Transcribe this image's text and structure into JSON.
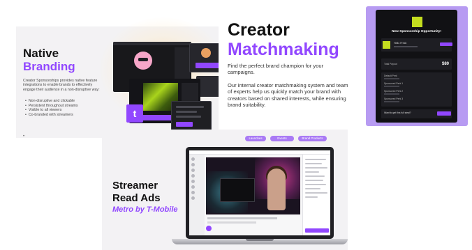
{
  "native_branding": {
    "title_line1": "Native",
    "title_line2": "Branding",
    "description": "Creator Sponsorships provides native feature integrations to enable brands to effectively engage their audience in a non-disruptive way:",
    "bullets": [
      "Non-disruptive and clickable",
      "Persistent throughout streams",
      "Visible to all viewers",
      "Co-branded with streamers"
    ],
    "footer_mark": "•",
    "logo_glyph": "t"
  },
  "creator_matchmaking": {
    "title_line1": "Creator",
    "title_line2": "Matchmaking",
    "paragraph1": "Find the perfect brand champion for your campaigns.",
    "paragraph2": "Our internal creator matchmaking system and team of experts help us quickly match your brand with creators based on shared interests, while ensuring brand suitability."
  },
  "sponsorship_card": {
    "heading": "New Sponsorship Opportunity!",
    "brand_name": "Hello Fresh",
    "total_label": "Total Payout",
    "total_value": "$80",
    "rows": [
      "Default Perk",
      "Sponsored Perk 1",
      "Sponsored Perk 2",
      "Sponsored Perk 3"
    ],
    "prompt": "Want to get this full steal?"
  },
  "streamer_read_ads": {
    "title_line1": "Streamer",
    "title_line2": "Read Ads",
    "subtitle": "Metro by T-Mobile",
    "tags": [
      "Launches",
      "Events",
      "Brand Products"
    ]
  },
  "colors": {
    "accent": "#9147ff",
    "card_bg": "#b79bf2",
    "dark": "#111114"
  }
}
